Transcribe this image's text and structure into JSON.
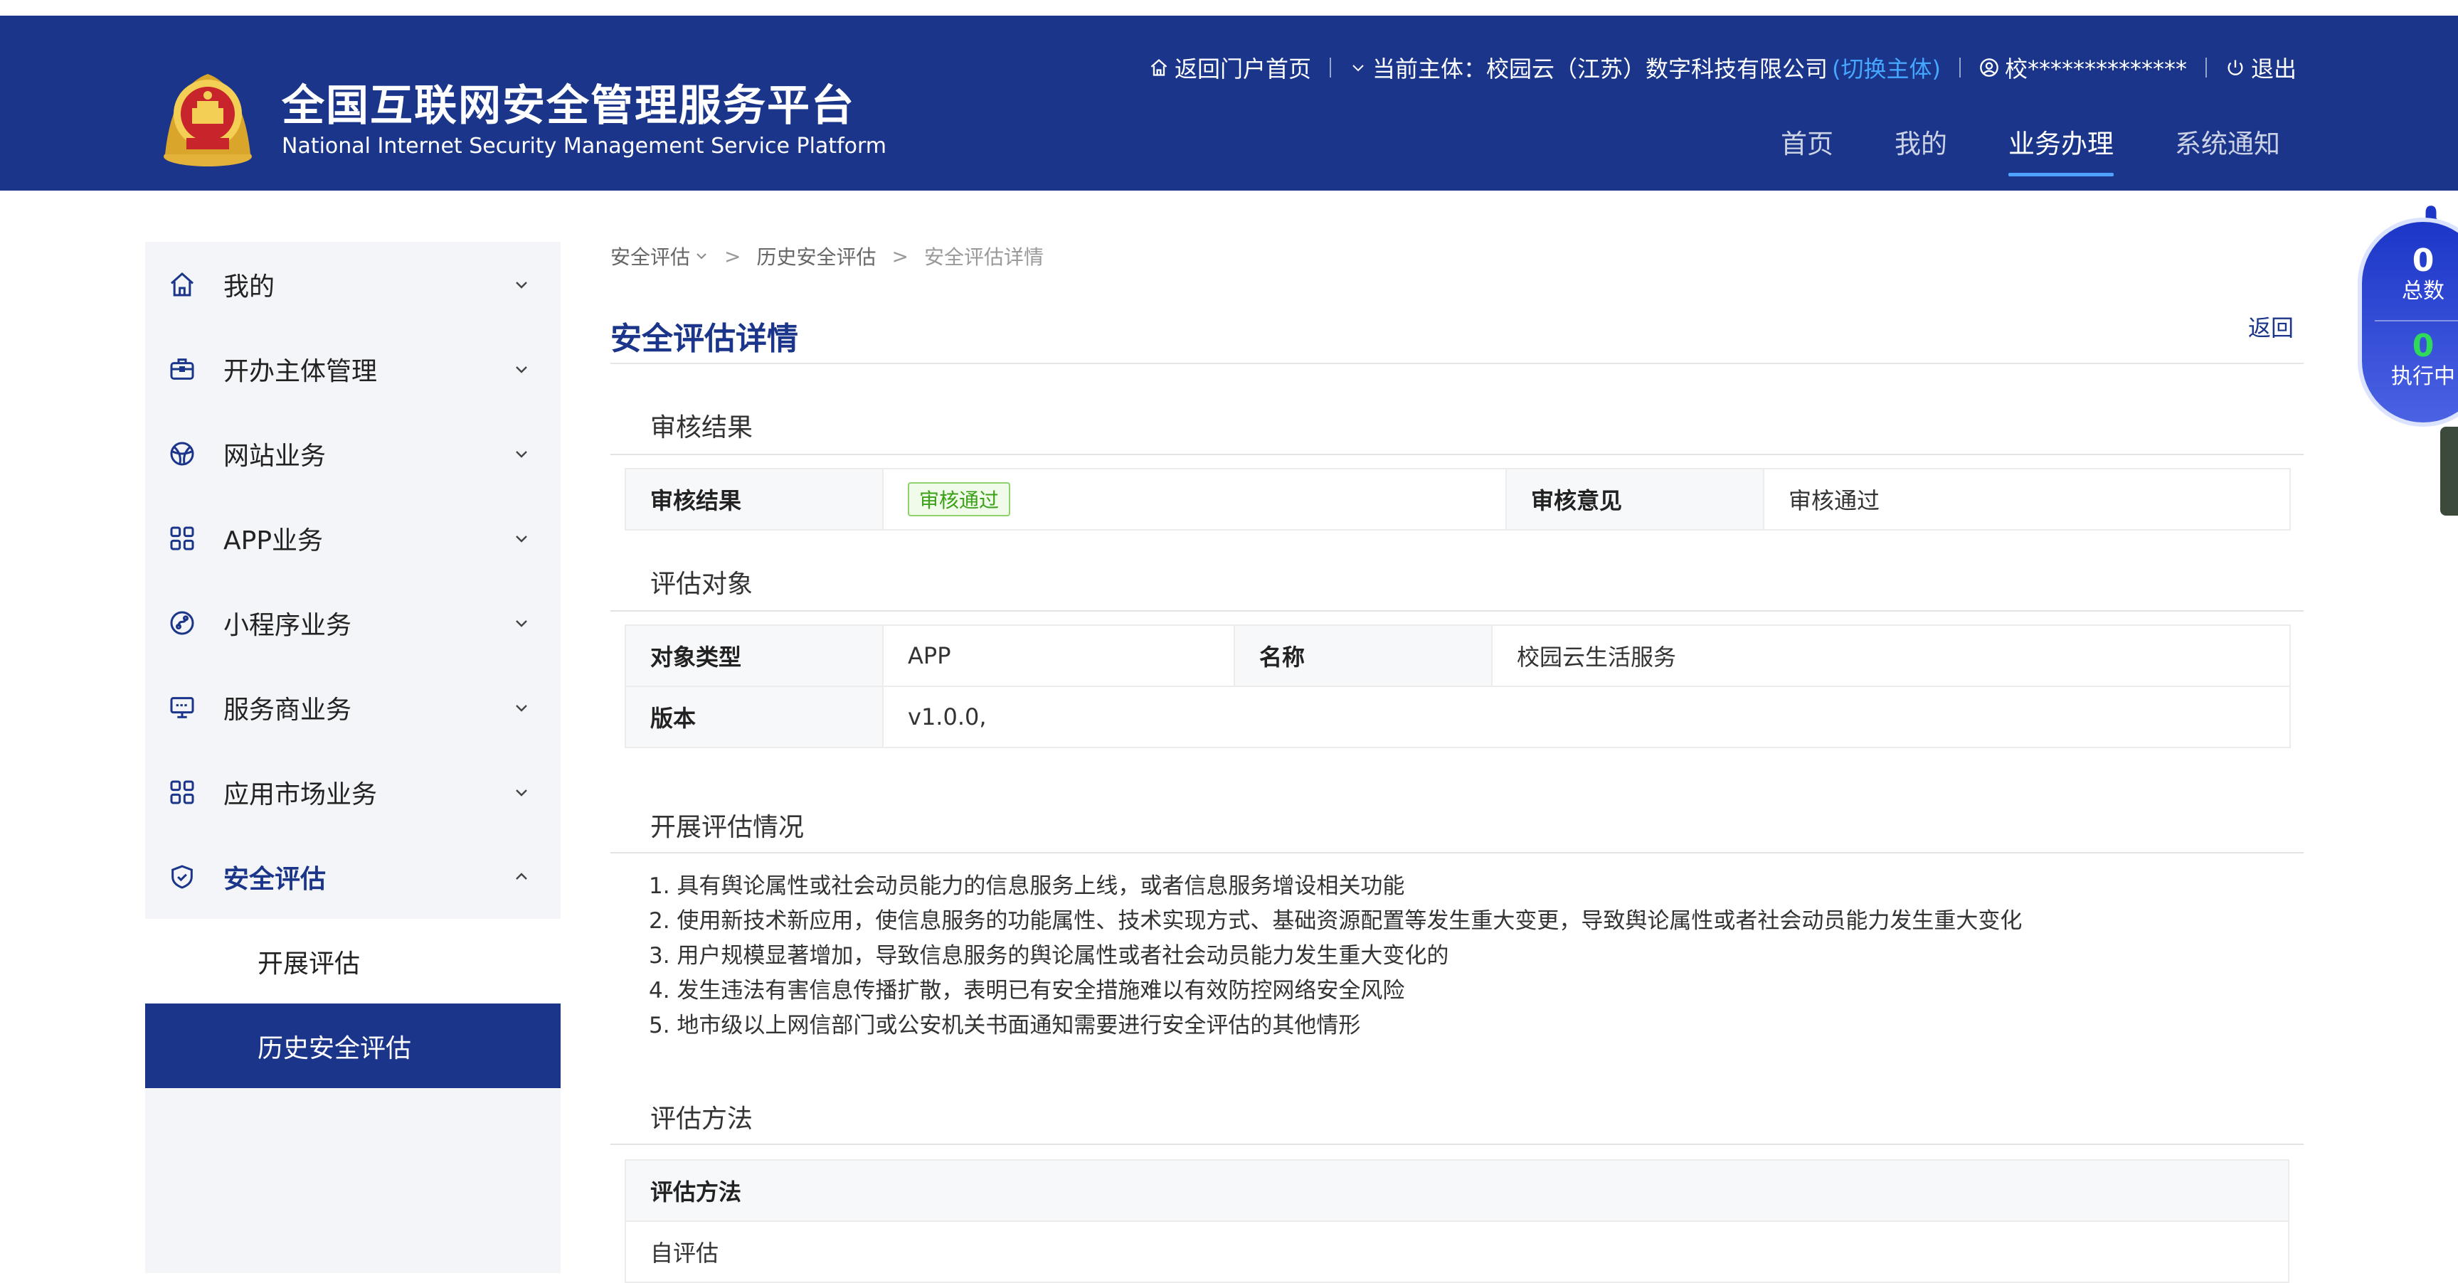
{
  "header": {
    "title_cn": "全国互联网安全管理服务平台",
    "title_en": "National Internet Security Management Service Platform",
    "portal_link": "返回门户首页",
    "entity_label": "当前主体：校园云（江苏）数字科技有限公司",
    "switch_entity": "(切换主体)",
    "user_name": "校**************",
    "logout": "退出",
    "nav": [
      {
        "label": "首页"
      },
      {
        "label": "我的"
      },
      {
        "label": "业务办理"
      },
      {
        "label": "系统通知"
      }
    ]
  },
  "sidebar": {
    "items": [
      {
        "label": "我的",
        "icon": "home-icon"
      },
      {
        "label": "开办主体管理",
        "icon": "briefcase-icon"
      },
      {
        "label": "网站业务",
        "icon": "globe-icon"
      },
      {
        "label": "APP业务",
        "icon": "grid-icon"
      },
      {
        "label": "小程序业务",
        "icon": "miniprogram-icon"
      },
      {
        "label": "服务商业务",
        "icon": "monitor-icon"
      },
      {
        "label": "应用市场业务",
        "icon": "grid-icon"
      },
      {
        "label": "安全评估",
        "icon": "shield-icon"
      }
    ],
    "sub_items": [
      {
        "label": "开展评估"
      },
      {
        "label": "历史安全评估"
      }
    ]
  },
  "breadcrumb": {
    "level1": "安全评估",
    "level2": "历史安全评估",
    "current": "安全评估详情"
  },
  "page": {
    "title": "安全评估详情",
    "back": "返回"
  },
  "review": {
    "section_title": "审核结果",
    "result_label": "审核结果",
    "result_value": "审核通过",
    "opinion_label": "审核意见",
    "opinion_value": "审核通过"
  },
  "target": {
    "section_title": "评估对象",
    "type_label": "对象类型",
    "type_value": "APP",
    "name_label": "名称",
    "name_value": "校园云生活服务",
    "version_label": "版本",
    "version_value": "v1.0.0,"
  },
  "situation": {
    "section_title": "开展评估情况",
    "reasons": [
      "1. 具有舆论属性或社会动员能力的信息服务上线，或者信息服务增设相关功能",
      "2. 使用新技术新应用，使信息服务的功能属性、技术实现方式、基础资源配置等发生重大变更，导致舆论属性或者社会动员能力发生重大变化",
      "3. 用户规模显著增加，导致信息服务的舆论属性或者社会动员能力发生重大变化的",
      "4. 发生违法有害信息传播扩散，表明已有安全措施难以有效防控网络安全风险",
      "5. 地市级以上网信部门或公安机关书面通知需要进行安全评估的其他情形"
    ]
  },
  "method": {
    "section_title": "评估方法",
    "col_label": "评估方法",
    "value": "自评估"
  },
  "task_widget": {
    "total_count": "0",
    "total_label": "总数",
    "running_count": "0",
    "running_label": "执行中"
  },
  "colors": {
    "brand": "#1a3589",
    "accent": "#4fa3ff",
    "success": "#3aa118",
    "sidebar_bg": "#f4f5f8"
  }
}
